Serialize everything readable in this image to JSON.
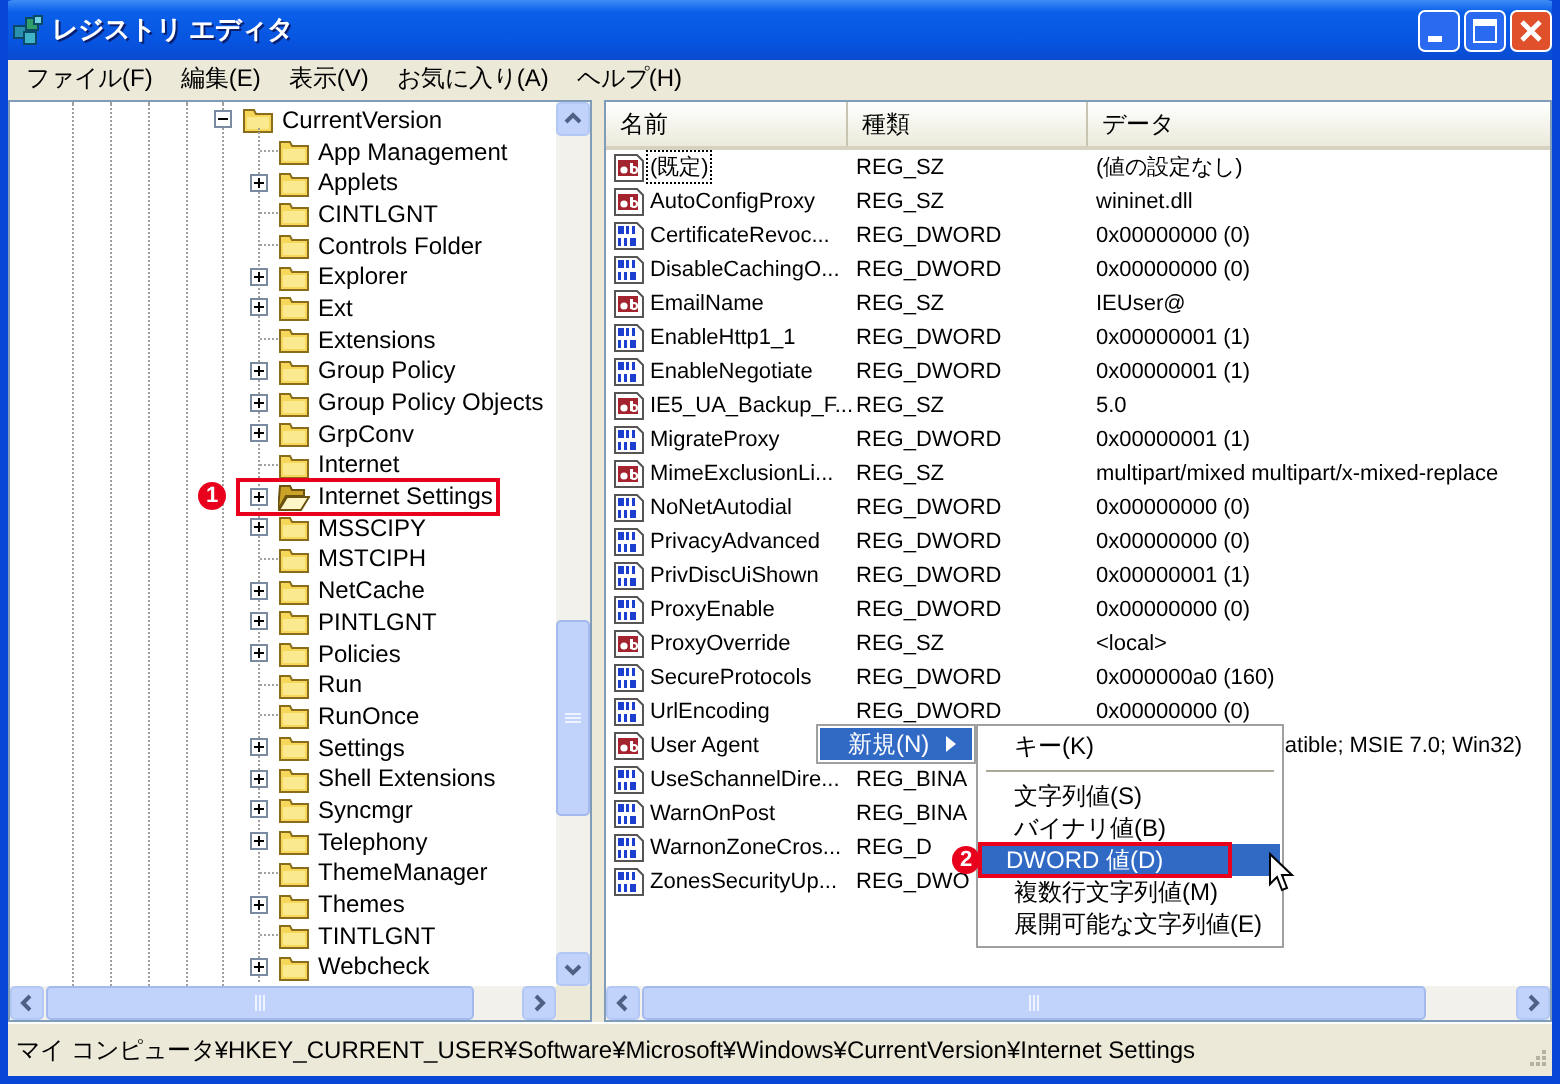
{
  "window": {
    "title": "レジストリ エディタ"
  },
  "menu_bar": [
    "ファイル(F)",
    "編集(E)",
    "表示(V)",
    "お気に入り(A)",
    "ヘルプ(H)"
  ],
  "tree": [
    {
      "label": "CurrentVersion",
      "expanded": true,
      "selected": false,
      "children": [
        {
          "label": "App Management",
          "expandable": false,
          "selected": false
        },
        {
          "label": "Applets",
          "expandable": true,
          "selected": false
        },
        {
          "label": "CINTLGNT",
          "expandable": false,
          "selected": false
        },
        {
          "label": "Controls Folder",
          "expandable": false,
          "selected": false
        },
        {
          "label": "Explorer",
          "expandable": true,
          "selected": false
        },
        {
          "label": "Ext",
          "expandable": true,
          "selected": false
        },
        {
          "label": "Extensions",
          "expandable": false,
          "selected": false
        },
        {
          "label": "Group Policy",
          "expandable": true,
          "selected": false
        },
        {
          "label": "Group Policy Objects",
          "expandable": true,
          "selected": false
        },
        {
          "label": "GrpConv",
          "expandable": true,
          "selected": false
        },
        {
          "label": "Internet",
          "expandable": false,
          "selected": false
        },
        {
          "label": "Internet Settings",
          "expandable": true,
          "selected": true,
          "marker": "1"
        },
        {
          "label": "MSSCIPY",
          "expandable": true,
          "selected": false
        },
        {
          "label": "MSTCIPH",
          "expandable": false,
          "selected": false
        },
        {
          "label": "NetCache",
          "expandable": true,
          "selected": false
        },
        {
          "label": "PINTLGNT",
          "expandable": true,
          "selected": false
        },
        {
          "label": "Policies",
          "expandable": true,
          "selected": false
        },
        {
          "label": "Run",
          "expandable": false,
          "selected": false
        },
        {
          "label": "RunOnce",
          "expandable": false,
          "selected": false
        },
        {
          "label": "Settings",
          "expandable": true,
          "selected": false
        },
        {
          "label": "Shell Extensions",
          "expandable": true,
          "selected": false
        },
        {
          "label": "Syncmgr",
          "expandable": true,
          "selected": false
        },
        {
          "label": "Telephony",
          "expandable": true,
          "selected": false
        },
        {
          "label": "ThemeManager",
          "expandable": false,
          "selected": false
        },
        {
          "label": "Themes",
          "expandable": true,
          "selected": false
        },
        {
          "label": "TINTLGNT",
          "expandable": false,
          "selected": false
        },
        {
          "label": "Webcheck",
          "expandable": true,
          "selected": false
        }
      ]
    }
  ],
  "list": {
    "columns": [
      "名前",
      "種類",
      "データ"
    ],
    "rows": [
      {
        "kind": "sz",
        "name": "(既定)",
        "type": "REG_SZ",
        "data": "(値の設定なし)",
        "focused": true
      },
      {
        "kind": "sz",
        "name": "AutoConfigProxy",
        "type": "REG_SZ",
        "data": "wininet.dll",
        "focused": false
      },
      {
        "kind": "dword",
        "name": "CertificateRevoc...",
        "type": "REG_DWORD",
        "data": "0x00000000 (0)",
        "focused": false
      },
      {
        "kind": "dword",
        "name": "DisableCachingO...",
        "type": "REG_DWORD",
        "data": "0x00000000 (0)",
        "focused": false
      },
      {
        "kind": "sz",
        "name": "EmailName",
        "type": "REG_SZ",
        "data": "IEUser@",
        "focused": false
      },
      {
        "kind": "dword",
        "name": "EnableHttp1_1",
        "type": "REG_DWORD",
        "data": "0x00000001 (1)",
        "focused": false
      },
      {
        "kind": "dword",
        "name": "EnableNegotiate",
        "type": "REG_DWORD",
        "data": "0x00000001 (1)",
        "focused": false
      },
      {
        "kind": "sz",
        "name": "IE5_UA_Backup_F...",
        "type": "REG_SZ",
        "data": "5.0",
        "focused": false
      },
      {
        "kind": "dword",
        "name": "MigrateProxy",
        "type": "REG_DWORD",
        "data": "0x00000001 (1)",
        "focused": false
      },
      {
        "kind": "sz",
        "name": "MimeExclusionLi...",
        "type": "REG_SZ",
        "data": "multipart/mixed multipart/x-mixed-replace",
        "focused": false
      },
      {
        "kind": "dword",
        "name": "NoNetAutodial",
        "type": "REG_DWORD",
        "data": "0x00000000 (0)",
        "focused": false
      },
      {
        "kind": "dword",
        "name": "PrivacyAdvanced",
        "type": "REG_DWORD",
        "data": "0x00000000 (0)",
        "focused": false
      },
      {
        "kind": "dword",
        "name": "PrivDiscUiShown",
        "type": "REG_DWORD",
        "data": "0x00000001 (1)",
        "focused": false
      },
      {
        "kind": "dword",
        "name": "ProxyEnable",
        "type": "REG_DWORD",
        "data": "0x00000000 (0)",
        "focused": false
      },
      {
        "kind": "sz",
        "name": "ProxyOverride",
        "type": "REG_SZ",
        "data": "<local>",
        "focused": false
      },
      {
        "kind": "dword",
        "name": "SecureProtocols",
        "type": "REG_DWORD",
        "data": "0x000000a0 (160)",
        "focused": false
      },
      {
        "kind": "dword",
        "name": "UrlEncoding",
        "type": "REG_DWORD",
        "data": "0x00000000 (0)",
        "focused": false
      },
      {
        "kind": "sz",
        "name": "User Agent",
        "data": "atible; MSIE 7.0; Win32)",
        "focused": false,
        "covered": true
      },
      {
        "kind": "dword",
        "name": "UseSchannelDire...",
        "type": "REG_BINA",
        "focused": false
      },
      {
        "kind": "dword",
        "name": "WarnOnPost",
        "type": "REG_BINA",
        "focused": false
      },
      {
        "kind": "dword",
        "name": "WarnonZoneCros...",
        "type": "REG_D",
        "focused": false
      },
      {
        "kind": "dword",
        "name": "ZonesSecurityUp...",
        "type": "REG_DWO",
        "focused": false
      }
    ]
  },
  "context_menu": {
    "items": [
      {
        "label": "新規(N)",
        "selected": true,
        "has_submenu": true
      }
    ],
    "submenu": [
      {
        "kind": "item",
        "label": "キー(K)",
        "selected": false
      },
      {
        "kind": "separator"
      },
      {
        "kind": "item",
        "label": "文字列値(S)",
        "selected": false
      },
      {
        "kind": "item",
        "label": "バイナリ値(B)",
        "selected": false
      },
      {
        "kind": "item",
        "label": "DWORD 値(D)",
        "selected": true,
        "marker": "2"
      },
      {
        "kind": "item",
        "label": "複数行文字列値(M)",
        "selected": false
      },
      {
        "kind": "item",
        "label": "展開可能な文字列値(E)",
        "selected": false
      }
    ]
  },
  "status_bar": "マイ コンピュータ¥HKEY_CURRENT_USER¥Software¥Microsoft¥Windows¥CurrentVersion¥Internet Settings"
}
